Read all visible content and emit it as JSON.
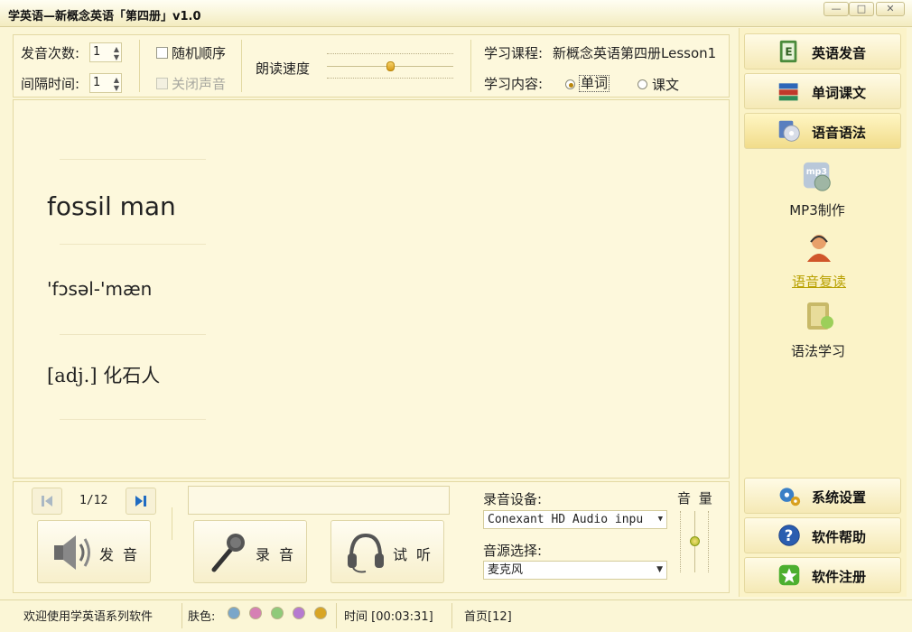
{
  "window": {
    "title": "学英语—新概念英语「第四册」v1.0",
    "btn_min": "—",
    "btn_max": "□",
    "btn_close": "✕"
  },
  "settings": {
    "play_count_label": "发音次数:",
    "play_count_value": "1",
    "interval_label": "间隔时间:",
    "interval_value": "1",
    "random_order_label": "随机顺序",
    "mute_label": "关闭声音",
    "speed_label": "朗读速度",
    "course_label": "学习课程:",
    "course_value": "新概念英语第四册Lesson1",
    "content_label": "学习内容:",
    "content_options": [
      "单词",
      "课文"
    ],
    "content_selected": "单词"
  },
  "word": {
    "text": "fossil man",
    "phonetic": "'fɔsəl-'mæn",
    "definition": "[adj.] 化石人"
  },
  "player": {
    "position": "1/12",
    "speak_label": "发音",
    "record_label": "录音",
    "listen_label": "试听",
    "record_device_label": "录音设备:",
    "record_device_value": "Conexant HD Audio inpu",
    "source_label": "音源选择:",
    "source_value": "麦克风",
    "volume_label": "音 量",
    "volume_level": 0.5
  },
  "sidebar": {
    "top": [
      {
        "label": "英语发音",
        "icon": "english-book-icon"
      },
      {
        "label": "单词课文",
        "icon": "books-icon"
      },
      {
        "label": "语音语法",
        "icon": "audio-cd-icon"
      }
    ],
    "sub": [
      {
        "label": "MP3制作",
        "icon": "mp3-icon"
      },
      {
        "label": "语音复读",
        "icon": "headset-person-icon"
      },
      {
        "label": "语法学习",
        "icon": "notebook-icon"
      }
    ],
    "bottom": [
      {
        "label": "系统设置",
        "icon": "gears-icon"
      },
      {
        "label": "软件帮助",
        "icon": "help-icon"
      },
      {
        "label": "软件注册",
        "icon": "register-icon"
      }
    ]
  },
  "status": {
    "welcome": "欢迎使用学英语系列软件",
    "skin_label": "肤色:",
    "skin_colors": [
      "#7aa6c9",
      "#d680b4",
      "#8fca7a",
      "#b67ad0",
      "#d8a524"
    ],
    "time": "时间 [00:03:31]",
    "page": "首页[12]"
  }
}
